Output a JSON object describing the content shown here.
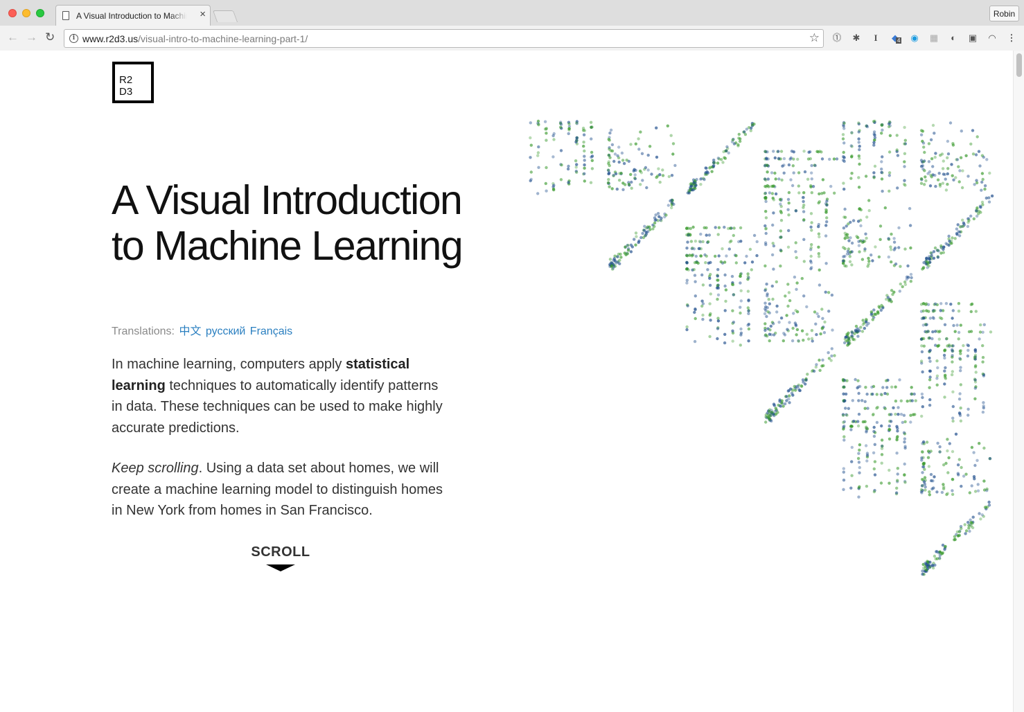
{
  "browser": {
    "tab_title": "A Visual Introduction to Machine Learning",
    "url_domain": "www.r2d3.us",
    "url_path": "/visual-intro-to-machine-learning-part-1/",
    "profile_name": "Robin",
    "extension_badge": "4"
  },
  "page": {
    "logo_line1": "R2",
    "logo_line2": "D3",
    "title": "A Visual Introduction to Machine Learning",
    "translations_label": "Translations:",
    "translations": [
      "中文",
      "русский",
      "Français"
    ],
    "intro": {
      "before_bold": "In machine learning, computers apply ",
      "bold": "statistical learning",
      "after_bold": " techniques to automatically identify patterns in data. These techniques can be used to make highly accurate predictions."
    },
    "keep_scrolling": {
      "italic": "Keep scrolling",
      "rest": ". Using a data set about homes, we will create a machine learning model to distinguish homes in New York from homes in San Francisco."
    },
    "scroll_label": "SCROLL"
  },
  "colors": {
    "new_york": "#1f4e8c",
    "san_francisco": "#3a9a2e",
    "link": "#2a7fc0"
  },
  "icons": [
    "page-icon",
    "close-icon",
    "back-arrow-icon",
    "forward-arrow-icon",
    "reload-icon",
    "info-icon",
    "star-icon",
    "scroll-down-arrow-icon"
  ]
}
